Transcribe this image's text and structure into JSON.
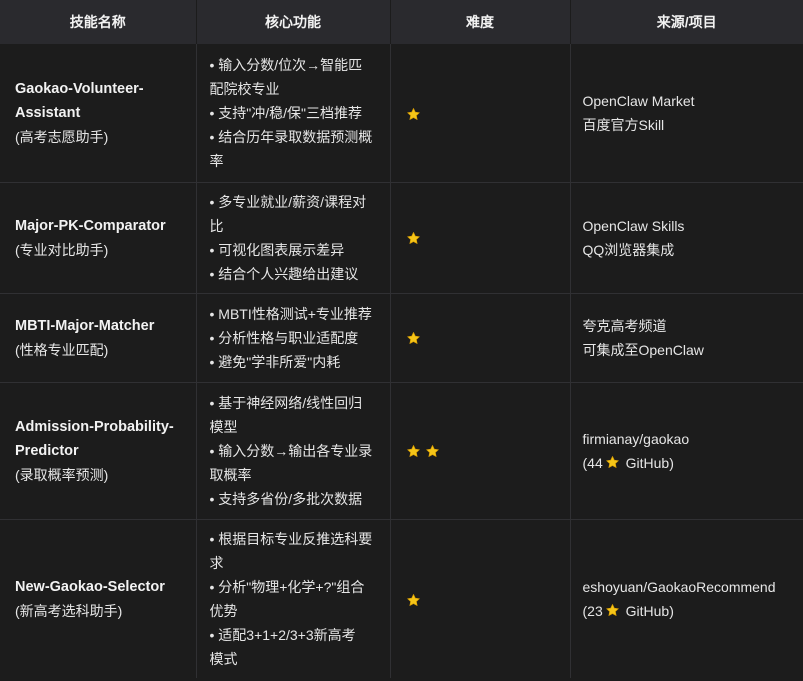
{
  "header": {
    "col1": "技能名称",
    "col2": "核心功能",
    "col3": "难度",
    "col4": "来源/项目",
    "download_icon": "download-icon"
  },
  "rows": [
    {
      "name": "Gaokao-Volunteer-Assistant",
      "name_lines": [
        "Gaokao-Volunteer-",
        "Assistant"
      ],
      "sub": "(高考志愿助手)",
      "functions": [
        "• 输入分数/位次→智能匹配院校专业",
        "• 支持\"冲/稳/保\"三档推荐",
        "• 结合历年录取数据预测概率"
      ],
      "func_lines": [
        [
          "• 输入分数/位次→智能匹",
          "配院校专业"
        ],
        [
          "• 支持\"冲/稳/保\"三档推荐"
        ],
        [
          "• 结合历年录取数据预测概",
          "率"
        ]
      ],
      "difficulty": 1,
      "source": [
        "OpenClaw Market",
        "百度官方Skill"
      ]
    },
    {
      "name": "Major-PK-Comparator",
      "name_lines": [
        "Major-PK-Comparator"
      ],
      "sub": "(专业对比助手)",
      "functions": [
        "• 多专业就业/薪资/课程对比",
        "• 可视化图表展示差异",
        "• 结合个人兴趣给出建议"
      ],
      "func_lines": [
        [
          "• 多专业就业/薪资/课程对",
          "比"
        ],
        [
          "• 可视化图表展示差异"
        ],
        [
          "• 结合个人兴趣给出建议"
        ]
      ],
      "difficulty": 1,
      "source": [
        "OpenClaw Skills",
        "QQ浏览器集成"
      ]
    },
    {
      "name": "MBTI-Major-Matcher",
      "name_lines": [
        "MBTI-Major-Matcher"
      ],
      "sub": "(性格专业匹配)",
      "functions": [
        "• MBTI性格测试+专业推荐",
        "• 分析性格与职业适配度",
        "• 避免\"学非所爱\"内耗"
      ],
      "func_lines": [
        [
          "• MBTI性格测试+专业推荐"
        ],
        [
          "• 分析性格与职业适配度"
        ],
        [
          "• 避免\"学非所爱\"内耗"
        ]
      ],
      "difficulty": 1,
      "source": [
        "夸克高考频道",
        "可集成至OpenClaw"
      ]
    },
    {
      "name": "Admission-Probability-Predictor",
      "name_lines": [
        "Admission-Probability-",
        "Predictor"
      ],
      "sub": "(录取概率预测)",
      "functions": [
        "• 基于神经网络/线性回归模型",
        "• 输入分数→输出各专业录取概率",
        "• 支持多省份/多批次数据"
      ],
      "func_lines": [
        [
          "• 基于神经网络/线性回归",
          "模型"
        ],
        [
          "• 输入分数→输出各专业录",
          "取概率"
        ],
        [
          "• 支持多省份/多批次数据"
        ]
      ],
      "difficulty": 2,
      "source": [
        "firmianay/gaokao",
        "(44",
        "GitHub)"
      ]
    },
    {
      "name": "New-Gaokao-Selector",
      "name_lines": [
        "New-Gaokao-Selector"
      ],
      "sub": "(新高考选科助手)",
      "functions": [
        "• 根据目标专业反推选科要求",
        "• 分析\"物理+化学+?\"组合优势",
        "• 适配3+1+2/3+3新高考模式"
      ],
      "func_lines": [
        [
          "• 根据目标专业反推选科要",
          "求"
        ],
        [
          "• 分析\"物理+化学+?\"组合",
          "优势"
        ],
        [
          "• 适配3+1+2/3+3新高考",
          "模式"
        ]
      ],
      "difficulty": 1,
      "source": [
        "eshoyuan/GaokaoRecommend",
        "(23",
        "GitHub)"
      ]
    }
  ],
  "star_color": "#f5c518",
  "star_icon": "star-icon"
}
